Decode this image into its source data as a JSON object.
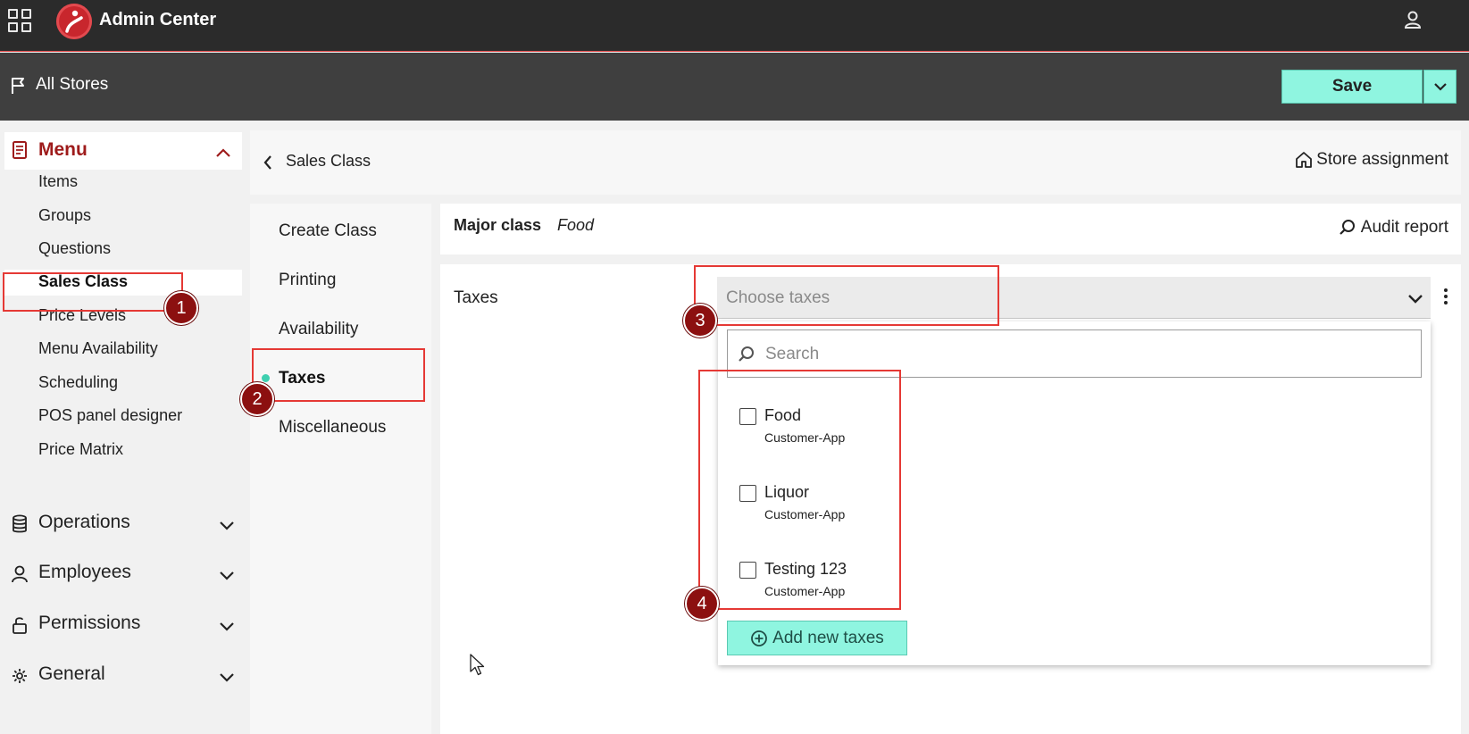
{
  "topbar": {
    "title": "Admin Center"
  },
  "subbar": {
    "store_label": "All Stores",
    "save_label": "Save"
  },
  "sidebar": {
    "menu_title": "Menu",
    "items": [
      "Items",
      "Groups",
      "Questions",
      "Sales Class",
      "Price Levels",
      "Menu Availability",
      "Scheduling",
      "POS panel designer",
      "Price Matrix"
    ],
    "active_item": "Sales Class",
    "groups": [
      {
        "label": "Operations",
        "icon": "database-icon"
      },
      {
        "label": "Employees",
        "icon": "person-icon"
      },
      {
        "label": "Permissions",
        "icon": "lock-icon"
      },
      {
        "label": "General",
        "icon": "gear-icon"
      }
    ]
  },
  "header": {
    "breadcrumb": "Sales Class",
    "store_assignment": "Store assignment"
  },
  "tabs": {
    "items": [
      "Create Class",
      "Printing",
      "Availability",
      "Taxes",
      "Miscellaneous"
    ],
    "active": "Taxes"
  },
  "major": {
    "label": "Major class",
    "value": "Food",
    "audit_report": "Audit report"
  },
  "taxes": {
    "label": "Taxes",
    "placeholder": "Choose taxes",
    "search_placeholder": "Search",
    "options": [
      {
        "name": "Food",
        "sub": "Customer-App",
        "checked": false
      },
      {
        "name": "Liquor",
        "sub": "Customer-App",
        "checked": false
      },
      {
        "name": "Testing 123",
        "sub": "Customer-App",
        "checked": false
      }
    ],
    "add_label": "Add new taxes"
  },
  "annotations": {
    "markers": [
      "1",
      "2",
      "3",
      "4"
    ],
    "color": "#e53935"
  },
  "colors": {
    "accent": "#8ff5e0",
    "brand_red": "#9e1b1b",
    "topbar": "#2b2b2b",
    "subbar": "#3f3f3f"
  }
}
